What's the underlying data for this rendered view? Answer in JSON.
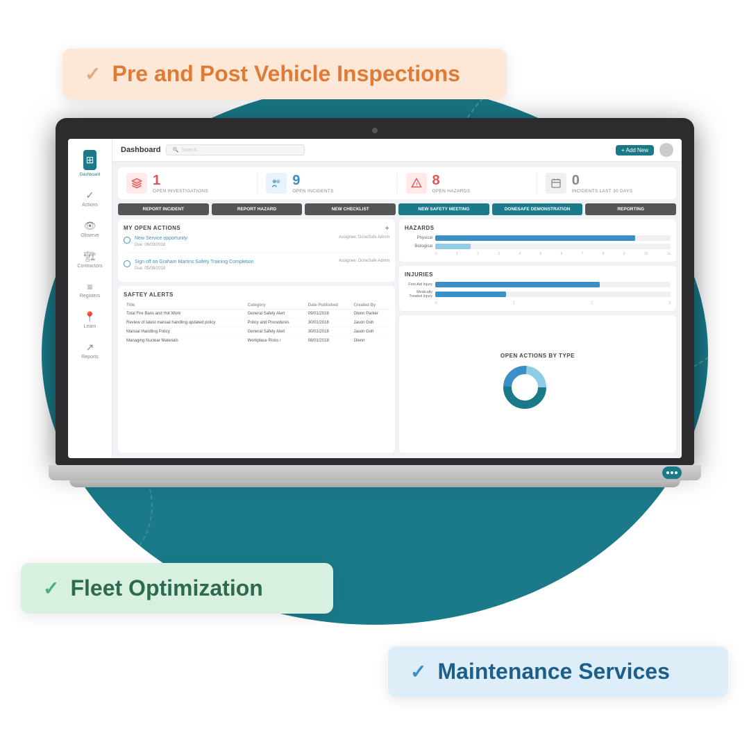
{
  "badges": {
    "inspections": {
      "label": "Pre and Post Vehicle Inspections",
      "check": "✓"
    },
    "fleet": {
      "label": "Fleet Optimization",
      "check": "✓"
    },
    "maintenance": {
      "label": "Maintenance Services",
      "check": "✓"
    }
  },
  "topbar": {
    "title": "Dashboard",
    "search_placeholder": "Search...",
    "add_label": "+ Add New"
  },
  "stats": [
    {
      "icon": "⚡",
      "number": "1",
      "label": "OPEN INVESTIGATIONS",
      "color": "red"
    },
    {
      "icon": "👥",
      "number": "9",
      "label": "OPEN INCIDENTS",
      "color": "blue"
    },
    {
      "icon": "⚠",
      "number": "8",
      "label": "OPEN HAZARDS",
      "color": "red"
    },
    {
      "icon": "📅",
      "number": "0",
      "label": "INCIDENTS LAST 30 DAYS",
      "color": "gray"
    }
  ],
  "action_buttons": [
    "REPORT INCIDENT",
    "REPORT HAZARD",
    "NEW CHECKLIST",
    "NEW SAFETY MEETING",
    "DONESAFE DEMONSTRATION",
    "REPORTING"
  ],
  "open_actions": {
    "title": "MY OPEN ACTIONS",
    "items": [
      {
        "text": "New Service opportunity",
        "due": "Due: 06/03/2018",
        "assignee": "Assignee: DoneSafe Admin"
      },
      {
        "text": "Sign off on Graham Martins Safety Training Completion",
        "due": "Due: 05/06/2018",
        "assignee": "Assignee: DoneSafe Admin"
      }
    ]
  },
  "safety_alerts": {
    "title": "SAFTEY ALERTS",
    "columns": [
      "Title",
      "Category",
      "Date Published",
      "Created By"
    ],
    "rows": [
      [
        "Total Fire Bans and Hot Work",
        "General Safety Alert",
        "09/01/2018",
        "Glenn Parker"
      ],
      [
        "Review of latest manual handling updated policy",
        "Policy and Procedures",
        "30/01/2018",
        "Jason Goh"
      ],
      [
        "Manual Handling Policy",
        "General Safety Alert",
        "30/01/2018",
        "Jason Goh"
      ],
      [
        "Managing Nuclear Materials",
        "Workplace Risks /",
        "08/01/2018",
        "Glenn"
      ]
    ]
  },
  "hazards": {
    "title": "HAZARDS",
    "bars": [
      {
        "label": "Physical",
        "value": 85,
        "color": "teal"
      },
      {
        "label": "Biological",
        "value": 15,
        "color": "light"
      }
    ],
    "axis": [
      "0",
      "1",
      "2",
      "3",
      "4",
      "5",
      "6",
      "7",
      "8",
      "9",
      "10",
      "11"
    ]
  },
  "injuries": {
    "title": "INJURIES",
    "bars": [
      {
        "label": "First Aid Injury",
        "value": 70,
        "color": "teal"
      },
      {
        "label": "Medically Treated Injury",
        "value": 30,
        "color": "teal"
      }
    ]
  },
  "actions_by_type": {
    "title": "OPEN ACTIONS BY TYPE"
  },
  "sidebar": {
    "items": [
      {
        "icon": "⊞",
        "label": "Dashboard",
        "active": true
      },
      {
        "icon": "✓",
        "label": "Actions"
      },
      {
        "icon": "👁",
        "label": "Observe"
      },
      {
        "icon": "🏗",
        "label": "Contractors"
      },
      {
        "icon": "≡",
        "label": "Registers"
      },
      {
        "icon": "📍",
        "label": "Learn"
      },
      {
        "icon": "↗",
        "label": "Reports"
      }
    ]
  }
}
